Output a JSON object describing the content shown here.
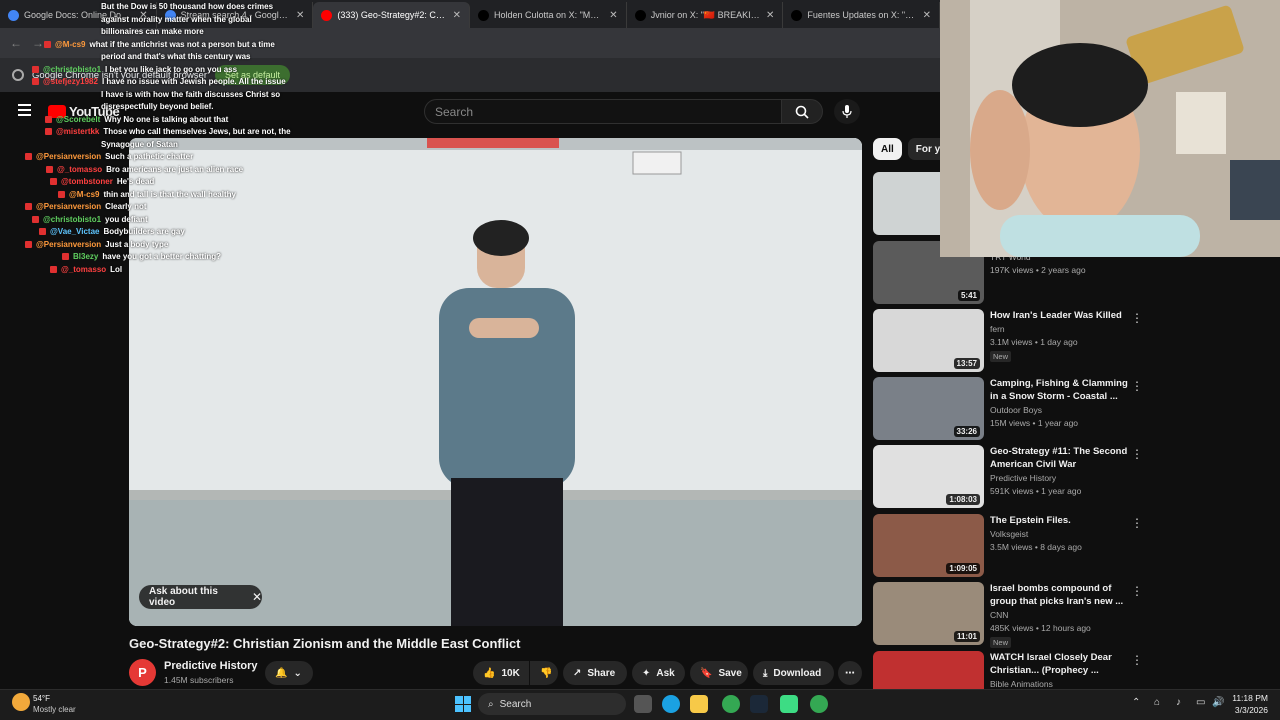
{
  "browser": {
    "tabs": [
      {
        "title": "Google Docs: Online Docume",
        "color": "#4285f4",
        "active": false
      },
      {
        "title": "Stream search 4 - Google Docs",
        "color": "#4285f4",
        "active": false
      },
      {
        "title": "(333) Geo-Strategy#2: Christian",
        "color": "#ff0000",
        "active": true
      },
      {
        "title": "Holden Culotta on X: \"MTG just",
        "color": "#000000",
        "active": false
      },
      {
        "title": "Jvnior on X: \"🇨🇳 BREAKING: I",
        "color": "#000000",
        "active": false
      },
      {
        "title": "Fuentes Updates on X: \"Nick Fu",
        "color": "#000000",
        "active": false
      }
    ],
    "infobar_text": "Google Chrome isn't your default browser",
    "infobar_button": "Set as default"
  },
  "youtube": {
    "logo": "YouTube",
    "search_placeholder": "Search",
    "video_title": "Geo-Strategy#2: Christian Zionism and the Middle East Conflict",
    "ask_chip": "Ask about this video",
    "channel": {
      "initial": "P",
      "name": "Predictive History",
      "subscribers": "1.45M subscribers"
    },
    "actions": {
      "likes": "10K",
      "share": "Share",
      "ask": "Ask",
      "save": "Save",
      "download": "Download"
    },
    "chips": [
      "All",
      "For yo"
    ]
  },
  "chat": [
    {
      "user": "",
      "msg": "But the Dow is 50 thousand how does crimes",
      "ucls": "g"
    },
    {
      "user": "",
      "msg": "against morality matter when the global",
      "ucls": "g"
    },
    {
      "user": "",
      "msg": "billionaires can make more",
      "ucls": "g"
    },
    {
      "user": "@M-cs9",
      "msg": "what if the antichrist was not a person but a time",
      "ucls": "o"
    },
    {
      "user": "",
      "msg": "period and that's what this century was",
      "ucls": "g"
    },
    {
      "user": "@christobisto1",
      "msg": "I bet you like jack to go on you ass",
      "ucls": "g"
    },
    {
      "user": "@stefjezy1982",
      "msg": "I have no issue with Jewish people. All the issue",
      "ucls": "r"
    },
    {
      "user": "",
      "msg": "I have is with how the faith discusses Christ so",
      "ucls": "g"
    },
    {
      "user": "",
      "msg": "disrespectfully beyond belief.",
      "ucls": "g"
    },
    {
      "user": "@Scorebelt",
      "msg": "Why No one is talking about that",
      "ucls": "g"
    },
    {
      "user": "@mistertkk",
      "msg": "Those who call themselves Jews, but are not, the",
      "ucls": "r"
    },
    {
      "user": "",
      "msg": "Synagogue of Satan",
      "ucls": "g"
    },
    {
      "user": "@Persianversion",
      "msg": "Such a pathetic chatter",
      "ucls": "o"
    },
    {
      "user": "@_tomasso",
      "msg": "Bro americans are just an alien race",
      "ucls": "r"
    },
    {
      "user": "@tombstoner",
      "msg": "He's dead",
      "ucls": "r"
    },
    {
      "user": "@M-cs9",
      "msg": "thin and tall is that the wall healthy",
      "ucls": "o"
    },
    {
      "user": "@Persianversion",
      "msg": "Clearly not",
      "ucls": "o"
    },
    {
      "user": "@christobisto1",
      "msg": "you defiant",
      "ucls": "g"
    },
    {
      "user": "@Vae_Victae",
      "msg": "Bodybuilders are gay",
      "ucls": "b"
    },
    {
      "user": "@Persianversion",
      "msg": "Just a body type",
      "ucls": "o"
    },
    {
      "user": "Bl3ezy",
      "msg": "have you got a better chatting?",
      "ucls": "g"
    },
    {
      "user": "@_tomasso",
      "msg": "Lol",
      "ucls": "r"
    }
  ],
  "recommendations": [
    {
      "title": "",
      "channel": "",
      "meta": "",
      "duration": "",
      "new": "",
      "thumb": "#cfd3d3"
    },
    {
      "title": "Israel's strategic weapon?",
      "channel": "TRT World",
      "meta": "197K views • 2 years ago",
      "duration": "5:41",
      "new": "",
      "thumb": "#5b5b5b"
    },
    {
      "title": "How Iran's Leader Was Killed",
      "channel": "fern",
      "meta": "3.1M views • 1 day ago",
      "duration": "13:57",
      "new": "New",
      "thumb": "#d8d8d8"
    },
    {
      "title": "Camping, Fishing & Clamming in a Snow Storm - Coastal ...",
      "channel": "Outdoor Boys",
      "meta": "15M views • 1 year ago",
      "duration": "33:26",
      "new": "",
      "thumb": "#7a8088"
    },
    {
      "title": "Geo-Strategy #11: The Second American Civil War",
      "channel": "Predictive History",
      "meta": "591K views • 1 year ago",
      "duration": "1:08:03",
      "new": "",
      "thumb": "#e0e0e0"
    },
    {
      "title": "The Epstein Files.",
      "channel": "Volksgeist",
      "meta": "3.5M views • 8 days ago",
      "duration": "1:09:05",
      "new": "",
      "thumb": "#8c5a48"
    },
    {
      "title": "Israel bombs compound of group that picks Iran's new ...",
      "channel": "CNN",
      "meta": "485K views • 12 hours ago",
      "duration": "11:01",
      "new": "New",
      "thumb": "#9a8b7a"
    },
    {
      "title": "WATCH Israel Closely Dear Christian... (Prophecy ...",
      "channel": "Bible Animations",
      "meta": "",
      "duration": "",
      "new": "",
      "thumb": "#c03030"
    }
  ],
  "taskbar": {
    "weather_temp": "54°F",
    "weather_desc": "Mostly clear",
    "search": "Search",
    "time": "11:18 PM",
    "date": "3/3/2026"
  }
}
